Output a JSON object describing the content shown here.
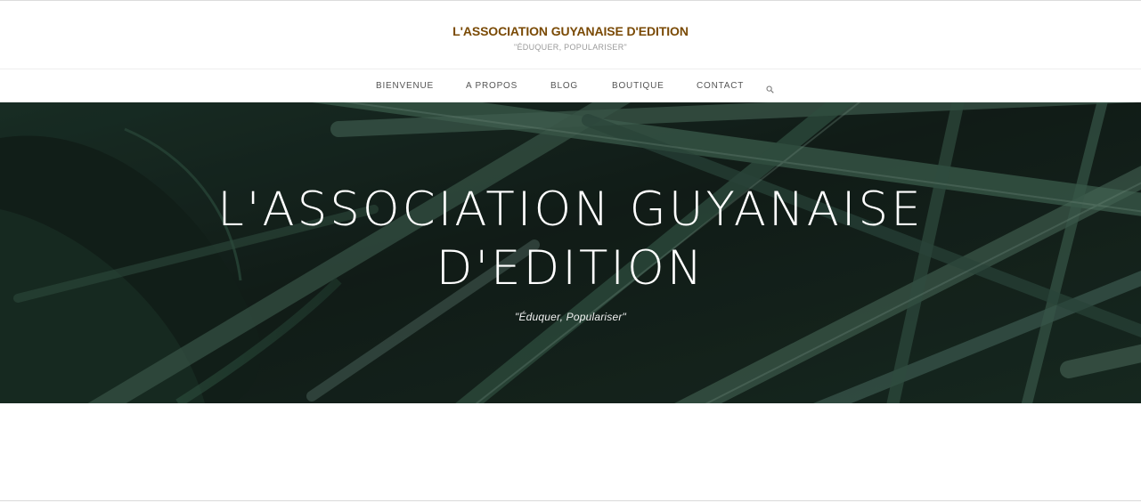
{
  "header": {
    "site_title": "L'ASSOCIATION GUYANAISE D'EDITION",
    "tagline": "\"ÉDUQUER, POPULARISER\""
  },
  "nav": {
    "items": [
      {
        "label": "BIENVENUE"
      },
      {
        "label": "A PROPOS"
      },
      {
        "label": "BLOG"
      },
      {
        "label": "BOUTIQUE"
      },
      {
        "label": "CONTACT"
      }
    ],
    "search_icon": "search-icon"
  },
  "hero": {
    "title_line1": "L'ASSOCIATION GUYANAISE",
    "title_line2": "D'EDITION",
    "subtitle": "\"Éduquer, Populariser\"",
    "background": "dark-green-leaves-photo"
  },
  "colors": {
    "brand": "#7a4a05",
    "tagline": "#9a9a9a",
    "nav_text": "#555555"
  }
}
